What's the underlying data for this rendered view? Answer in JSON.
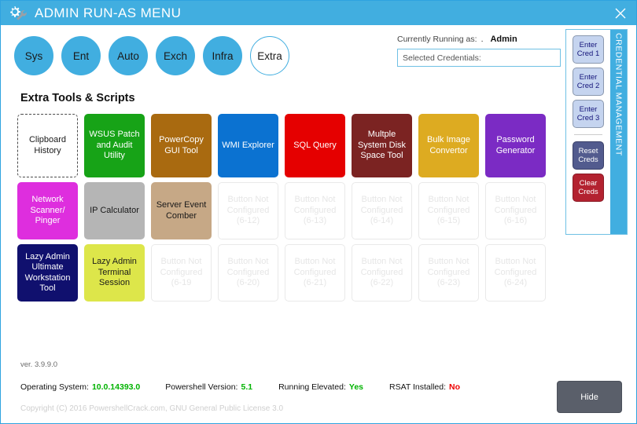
{
  "window": {
    "title": "ADMIN RUN-AS MENU",
    "icon": "gear-wrench-icon",
    "close_label": "close-icon",
    "titlebar_color": "#41aee0"
  },
  "categories": [
    {
      "label": "Sys",
      "selected": false
    },
    {
      "label": "Ent",
      "selected": false
    },
    {
      "label": "Auto",
      "selected": false
    },
    {
      "label": "Exch",
      "selected": false
    },
    {
      "label": "Infra",
      "selected": false
    },
    {
      "label": "Extra",
      "selected": true
    }
  ],
  "runas": {
    "label": "Currently Running as:",
    "separator": ".",
    "value": "Admin"
  },
  "selected_credentials": {
    "label": "Selected Credentials:",
    "value": ""
  },
  "credential_panel": {
    "vertical_title": "CREDENTIAL MANAGEMENT",
    "buttons": [
      {
        "label": "Enter\nCred 1",
        "style": "enter"
      },
      {
        "label": "Enter\nCred 2",
        "style": "enter"
      },
      {
        "label": "Enter\nCred 3",
        "style": "enter"
      },
      {
        "label": "Reset\nCreds",
        "style": "reset"
      },
      {
        "label": "Clear\nCreds",
        "style": "clear"
      }
    ]
  },
  "section": {
    "title": "Extra Tools & Scripts"
  },
  "tiles": [
    {
      "label": "Clipboard History",
      "bg": "#ffffff",
      "fg": "#1a1a1a",
      "variant": "dashed"
    },
    {
      "label": "WSUS Patch and Audit Utility",
      "bg": "#17a317",
      "fg": "#ffffff",
      "variant": "filled"
    },
    {
      "label": "PowerCopy GUI Tool",
      "bg": "#a96a10",
      "fg": "#ffffff",
      "variant": "filled"
    },
    {
      "label": "WMI Explorer",
      "bg": "#0b72d1",
      "fg": "#ffffff",
      "variant": "filled"
    },
    {
      "label": "SQL Query",
      "bg": "#e50000",
      "fg": "#ffffff",
      "variant": "filled"
    },
    {
      "label": "Multple System Disk Space Tool",
      "bg": "#7b2322",
      "fg": "#ffffff",
      "variant": "filled"
    },
    {
      "label": "Bulk Image Convertor",
      "bg": "#ddab21",
      "fg": "#ffffff",
      "variant": "filled"
    },
    {
      "label": "Password Generator",
      "bg": "#7b2bc4",
      "fg": "#ffffff",
      "variant": "filled"
    },
    {
      "label": "Network Scanner/ Pinger",
      "bg": "#de2ede",
      "fg": "#ffffff",
      "variant": "filled"
    },
    {
      "label": "IP Calculator",
      "bg": "#b5b5b5",
      "fg": "#1a1a1a",
      "variant": "filled"
    },
    {
      "label": "Server Event Comber",
      "bg": "#c6a886",
      "fg": "#1a1a1a",
      "variant": "filled"
    },
    {
      "label": "Button Not Configured (6-12)",
      "bg": "#ffffff",
      "fg": "#e6e6e6",
      "variant": "unconfigured"
    },
    {
      "label": "Button Not Configured (6-13)",
      "bg": "#ffffff",
      "fg": "#e6e6e6",
      "variant": "unconfigured"
    },
    {
      "label": "Button Not Configured (6-14)",
      "bg": "#ffffff",
      "fg": "#e6e6e6",
      "variant": "unconfigured"
    },
    {
      "label": "Button Not Configured (6-15)",
      "bg": "#ffffff",
      "fg": "#e6e6e6",
      "variant": "unconfigured"
    },
    {
      "label": "Button Not Configured (6-16)",
      "bg": "#ffffff",
      "fg": "#e6e6e6",
      "variant": "unconfigured"
    },
    {
      "label": "Lazy Admin Ultimate Workstation Tool",
      "bg": "#10106e",
      "fg": "#ffffff",
      "variant": "filled"
    },
    {
      "label": "Lazy Admin Terminal Session",
      "bg": "#dde64a",
      "fg": "#1a1a1a",
      "variant": "filled"
    },
    {
      "label": "Button Not Configured (6-19",
      "bg": "#ffffff",
      "fg": "#e6e6e6",
      "variant": "unconfigured"
    },
    {
      "label": "Button Not Configured (6-20)",
      "bg": "#ffffff",
      "fg": "#e6e6e6",
      "variant": "unconfigured"
    },
    {
      "label": "Button Not Configured (6-21)",
      "bg": "#ffffff",
      "fg": "#e6e6e6",
      "variant": "unconfigured"
    },
    {
      "label": "Button Not Configured (6-22)",
      "bg": "#ffffff",
      "fg": "#e6e6e6",
      "variant": "unconfigured"
    },
    {
      "label": "Button Not Configured (6-23)",
      "bg": "#ffffff",
      "fg": "#e6e6e6",
      "variant": "unconfigured"
    },
    {
      "label": "Button Not Configured (6-24)",
      "bg": "#ffffff",
      "fg": "#e6e6e6",
      "variant": "unconfigured"
    }
  ],
  "footer": {
    "version": "ver. 3.9.9.0",
    "stats": [
      {
        "label": "Operating System:",
        "value": "10.0.14393.0",
        "color": "#00b300"
      },
      {
        "label": "Powershell Version:",
        "value": "5.1",
        "color": "#00b300"
      },
      {
        "label": "Running Elevated:",
        "value": "Yes",
        "color": "#00b300"
      },
      {
        "label": "RSAT Installed:",
        "value": "No",
        "color": "#ee0000"
      }
    ],
    "copyright": "Copyright (C) 2016 PowershellCrack.com, GNU General Public License 3.0",
    "hide_label": "Hide"
  }
}
